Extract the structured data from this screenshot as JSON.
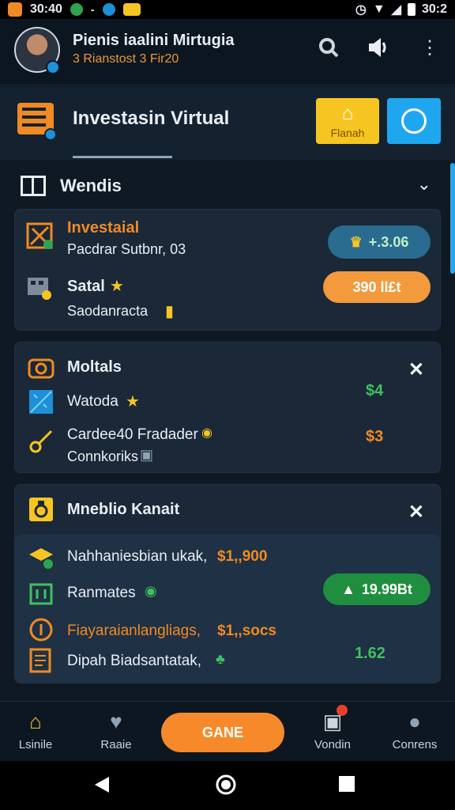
{
  "status_bar": {
    "time": "30:40",
    "time_right": "30:2"
  },
  "header": {
    "title": "Pienis iaalini Mirtugia",
    "subtitle": "3 Rianstost 3 Fir20"
  },
  "titlebar": {
    "title": "Investasin Virtual",
    "yellow_button_label": "Flanah"
  },
  "section": {
    "title": "Wendis"
  },
  "card1": {
    "row1_title": "Investaial",
    "row1_sub": "Pacdrar Sutbnr, 03",
    "row1_pill": "+.3.06",
    "row2_title": "Satal",
    "row2_sub": "Saodanracta",
    "row2_pill": "390 ll£t"
  },
  "card2": {
    "title": "Moltals",
    "row1": "Watoda",
    "row1_value": "$4",
    "row2": "Cardee40 Fradader",
    "row2_sub": "Connkoriks",
    "row2_value": "$3"
  },
  "card3": {
    "title": "Mneblio Kanait",
    "row1": "Nahhaniesbian ukak,",
    "row1_amount": "$1,,900",
    "row2": "Ranmates",
    "row2_pill": "19.99Bt",
    "row3": "Fiayaraianlangliags,",
    "row3_amount": "$1,,socs",
    "row4": "Dipah Biadsantatak,",
    "row4_value": "1.62"
  },
  "bottom_nav": {
    "item1": "Lsinile",
    "item2": "Raaie",
    "cta": "GANE",
    "item4": "Vondin",
    "item5": "Conrens"
  },
  "colors": {
    "accent_orange": "#f68a2b",
    "accent_yellow": "#f6c522",
    "accent_blue": "#1ea7ef",
    "green": "#2ea44f",
    "background": "#0f1924"
  }
}
